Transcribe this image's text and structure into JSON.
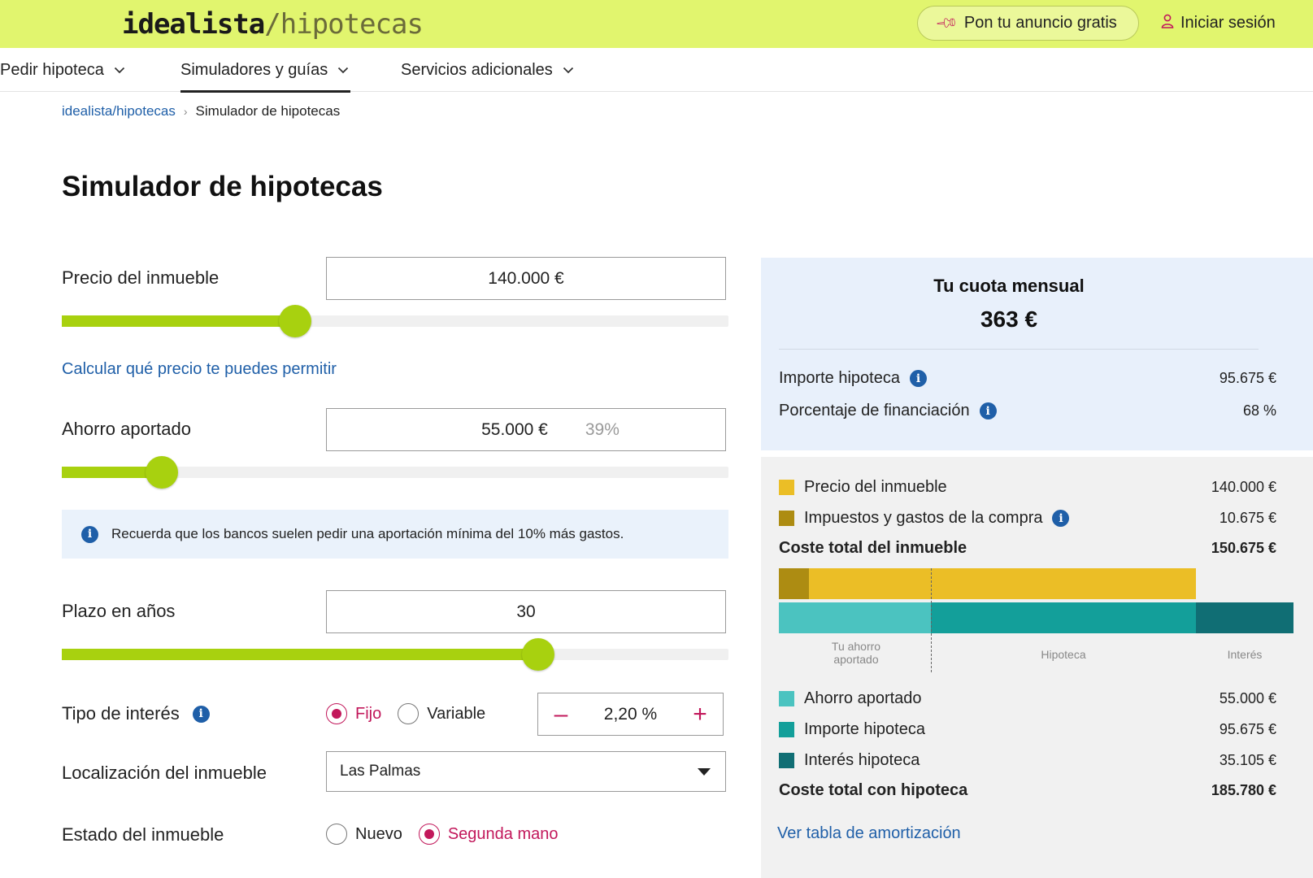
{
  "header": {
    "logo_main": "idealista",
    "logo_slash": "/",
    "logo_suffix": "hipotecas",
    "anuncio_button": "Pon tu anuncio gratis",
    "login_button": "Iniciar sesión"
  },
  "nav": {
    "items": [
      {
        "label": "Pedir hipoteca"
      },
      {
        "label": "Simuladores y guías"
      },
      {
        "label": "Servicios adicionales"
      }
    ],
    "active_index": 1
  },
  "breadcrumb": {
    "home": "idealista/hipotecas",
    "current": "Simulador de hipotecas"
  },
  "page_title": "Simulador de hipotecas",
  "form": {
    "precio": {
      "label": "Precio del inmueble",
      "value": "140.000 €",
      "slider_fraction": 0.35
    },
    "calc_link": "Calcular qué precio te puedes permitir",
    "ahorro": {
      "label": "Ahorro aportado",
      "value": "55.000 €",
      "percent": "39%",
      "slider_fraction": 0.15
    },
    "notice": "Recuerda que los bancos suelen pedir una aportación mínima del 10% más gastos.",
    "plazo": {
      "label": "Plazo en años",
      "value": "30",
      "slider_fraction": 0.715
    },
    "interes": {
      "label": "Tipo de interés",
      "options": [
        {
          "label": "Fijo",
          "checked": true
        },
        {
          "label": "Variable",
          "checked": false
        }
      ],
      "value": "2,20 %",
      "minus": "–",
      "plus": "+"
    },
    "localizacion": {
      "label": "Localización del inmueble",
      "value": "Las Palmas"
    },
    "estado": {
      "label": "Estado del inmueble",
      "options": [
        {
          "label": "Nuevo",
          "checked": false
        },
        {
          "label": "Segunda mano",
          "checked": true
        }
      ]
    }
  },
  "summary": {
    "cuota_label": "Tu cuota mensual",
    "cuota_value": "363 €",
    "importe_label": "Importe hipoteca",
    "importe_value": "95.675 €",
    "porcentaje_label": "Porcentaje de financiación",
    "porcentaje_value": "68 %"
  },
  "breakdown": {
    "precio": {
      "label": "Precio del inmueble",
      "value": "140.000 €",
      "color": "#ebbe26"
    },
    "impuestos": {
      "label": "Impuestos y gastos de la compra",
      "value": "10.675 €",
      "color": "#ad8c12"
    },
    "coste_inmueble": {
      "label": "Coste total del inmueble",
      "value": "150.675 €"
    },
    "bar_labels": {
      "ahorro": "Tu ahorro aportado",
      "hipoteca": "Hipoteca",
      "interes": "Interés"
    },
    "ahorro": {
      "label": "Ahorro aportado",
      "value": "55.000 €",
      "color": "#4bc3c0"
    },
    "importe": {
      "label": "Importe hipoteca",
      "value": "95.675 €",
      "color": "#139f9a"
    },
    "interes": {
      "label": "Interés hipoteca",
      "value": "35.105 €",
      "color": "#106e74"
    },
    "coste_hipoteca": {
      "label": "Coste total con hipoteca",
      "value": "185.780 €"
    },
    "amort_link": "Ver tabla de amortización"
  },
  "colors": {
    "brand_lime": "#e1f56e",
    "slider_green": "#a8d10f",
    "link_blue": "#1f5fa8",
    "accent_magenta": "#c2185b"
  },
  "icons": {
    "pin": "pin-icon",
    "user": "user-icon",
    "chevron": "chevron-down-icon",
    "info": "info-icon",
    "caret": "caret-down-icon"
  }
}
